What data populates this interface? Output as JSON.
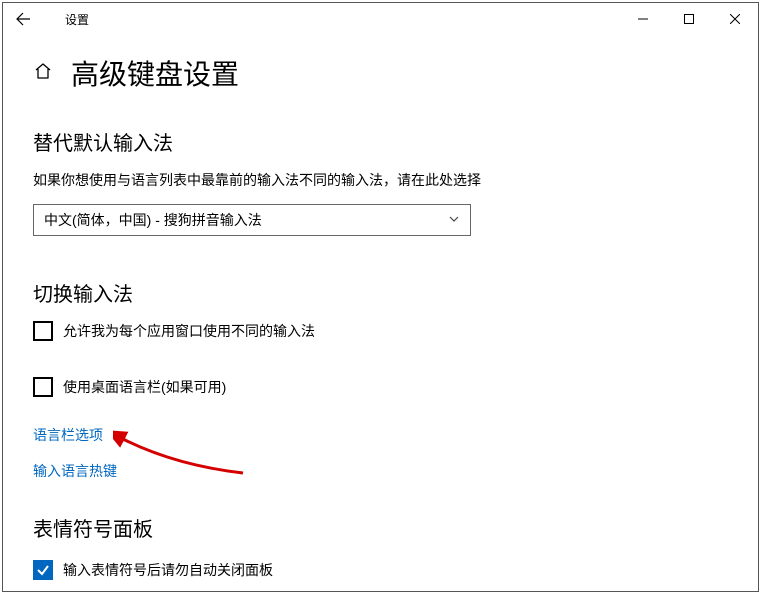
{
  "titlebar": {
    "title": "设置"
  },
  "page": {
    "title": "高级键盘设置"
  },
  "section1": {
    "title": "替代默认输入法",
    "desc": "如果你想使用与语言列表中最靠前的输入法不同的输入法，请在此处选择",
    "dropdown_value": "中文(简体，中国) - 搜狗拼音输入法"
  },
  "section2": {
    "title": "切换输入法",
    "checkbox1_label": "允许我为每个应用窗口使用不同的输入法",
    "checkbox2_label": "使用桌面语言栏(如果可用)",
    "link1": "语言栏选项",
    "link2": "输入语言热键"
  },
  "section3": {
    "title": "表情符号面板",
    "checkbox3_label": "输入表情符号后请勿自动关闭面板"
  }
}
